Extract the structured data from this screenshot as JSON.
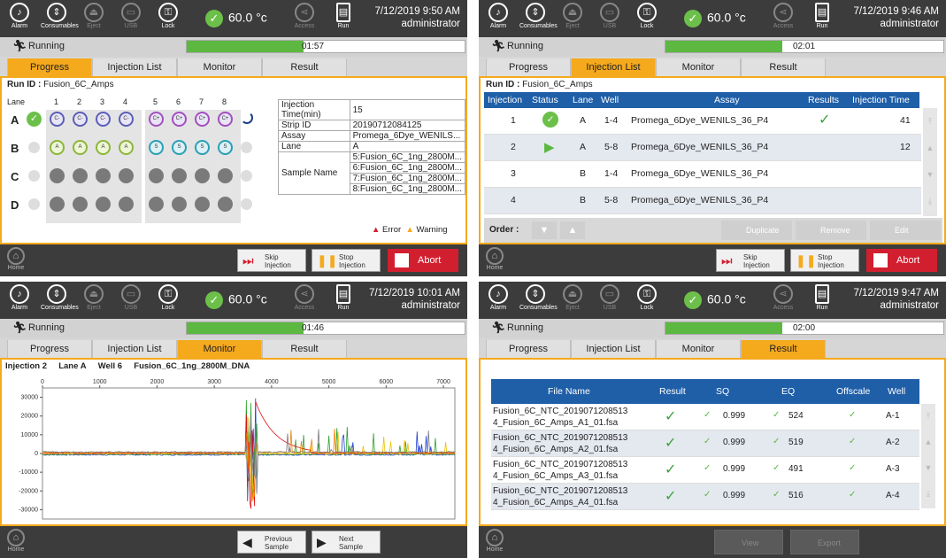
{
  "topbar": {
    "alarm": "Alarm",
    "consumables": "Consumables",
    "eject": "Eject",
    "usb": "USB",
    "lock": "Lock",
    "temp": "60.0 °c",
    "access": "Access",
    "run": "Run",
    "user": "administrator"
  },
  "panels": [
    {
      "datetime": "7/12/2019 9:50 AM",
      "status": "Running",
      "time": "01:57",
      "progress": 0.42,
      "active_tab": "Progress"
    },
    {
      "datetime": "7/12/2019 9:46 AM",
      "status": "Running",
      "time": "02:01",
      "progress": 0.42,
      "active_tab": "Injection List"
    },
    {
      "datetime": "7/12/2019 10:01 AM",
      "status": "Running",
      "time": "01:46",
      "progress": 0.42,
      "active_tab": "Monitor"
    },
    {
      "datetime": "7/12/2019 9:47 AM",
      "status": "Running",
      "time": "02:00",
      "progress": 0.42,
      "active_tab": "Result"
    }
  ],
  "tabs": [
    "Progress",
    "Injection List",
    "Monitor",
    "Result"
  ],
  "home": "Home",
  "run_id_label": "Run ID :",
  "run_id": "Fusion_6C_Amps",
  "plate": {
    "lane_label": "Lane",
    "cols": [
      "1",
      "2",
      "3",
      "4",
      "5",
      "6",
      "7",
      "8"
    ],
    "rows": [
      "A",
      "B",
      "C",
      "D"
    ],
    "rowA": [
      "C-",
      "C-",
      "C-",
      "C-",
      "C+",
      "C+",
      "C+",
      "C+"
    ],
    "rowB": [
      "A",
      "A",
      "A",
      "A",
      "S",
      "S",
      "S",
      "S"
    ]
  },
  "info": {
    "inj_time_label": "Injection Time(min)",
    "inj_time": "15",
    "strip_label": "Strip ID",
    "strip": "20190712084125",
    "assay_label": "Assay",
    "assay": "Promega_6Dye_WENILS...",
    "lane_label": "Lane",
    "lane": "A",
    "sample_label": "Sample Name",
    "samples": [
      "5:Fusion_6C_1ng_2800M...",
      "6:Fusion_6C_1ng_2800M...",
      "7:Fusion_6C_1ng_2800M...",
      "8:Fusion_6C_1ng_2800M..."
    ]
  },
  "legend": {
    "error": "Error",
    "warning": "Warning"
  },
  "buttons": {
    "skip": "Skip\nInjection",
    "skip1": "Skip",
    "skip2": "Injection",
    "stop1": "Stop",
    "stop2": "Injection",
    "abort": "Abort",
    "duplicate": "Duplicate",
    "remove": "Remove",
    "edit": "Edit",
    "prev1": "Previous",
    "prev2": "Sample",
    "next1": "Next",
    "next2": "Sample",
    "view": "View",
    "export": "Export"
  },
  "injlist": {
    "headers": [
      "Injection",
      "Status",
      "Lane",
      "Well",
      "Assay",
      "Results",
      "Injection Time"
    ],
    "rows": [
      {
        "inj": "1",
        "status": "done",
        "lane": "A",
        "well": "1-4",
        "assay": "Promega_6Dye_WENILS_36_P4",
        "result": "ok",
        "time": "41"
      },
      {
        "inj": "2",
        "status": "running",
        "lane": "A",
        "well": "5-8",
        "assay": "Promega_6Dye_WENILS_36_P4",
        "result": "",
        "time": "12"
      },
      {
        "inj": "3",
        "status": "",
        "lane": "B",
        "well": "1-4",
        "assay": "Promega_6Dye_WENILS_36_P4",
        "result": "",
        "time": ""
      },
      {
        "inj": "4",
        "status": "",
        "lane": "B",
        "well": "5-8",
        "assay": "Promega_6Dye_WENILS_36_P4",
        "result": "",
        "time": ""
      }
    ],
    "order_label": "Order :",
    "page": "1\n1"
  },
  "monitor": {
    "injection_label": "Injection",
    "injection": "2",
    "lane_label": "Lane",
    "lane": "A",
    "well_label": "Well",
    "well": "6",
    "sample": "Fusion_6C_1ng_2800M_DNA"
  },
  "chart_data": {
    "type": "line",
    "x": {
      "min": 0,
      "max": 7200,
      "ticks": [
        0,
        1000,
        2000,
        3000,
        4000,
        5000,
        6000,
        7000
      ]
    },
    "y": {
      "min": -35000,
      "max": 35000,
      "ticks": [
        30000,
        20000,
        10000,
        0,
        -10000,
        -20000,
        -30000
      ]
    },
    "series": [
      {
        "color": "#1f3fd0"
      },
      {
        "color": "#2ca02c"
      },
      {
        "color": "#e8c300"
      },
      {
        "color": "#e01010"
      },
      {
        "color": "#f08000"
      },
      {
        "color": "#7a7a7a"
      }
    ]
  },
  "results": {
    "headers": [
      "File Name",
      "Result",
      "SQ",
      "EQ",
      "Offscale",
      "Well"
    ],
    "rows": [
      {
        "file1": "Fusion_6C_NTC_2019071208513",
        "file2": "4_Fusion_6C_Amps_A1_01.fsa",
        "sq": "0.999",
        "eq": "524",
        "well": "A-1"
      },
      {
        "file1": "Fusion_6C_NTC_2019071208513",
        "file2": "4_Fusion_6C_Amps_A2_01.fsa",
        "sq": "0.999",
        "eq": "519",
        "well": "A-2"
      },
      {
        "file1": "Fusion_6C_NTC_2019071208513",
        "file2": "4_Fusion_6C_Amps_A3_01.fsa",
        "sq": "0.999",
        "eq": "491",
        "well": "A-3"
      },
      {
        "file1": "Fusion_6C_NTC_2019071208513",
        "file2": "4_Fusion_6C_Amps_A4_01.fsa",
        "sq": "0.999",
        "eq": "516",
        "well": "A-4"
      }
    ]
  },
  "colors": {
    "accent": "#f5a91d",
    "header_blue": "#1f5fa8",
    "ok_green": "#6cc04a",
    "abort_red": "#d21f2f"
  }
}
